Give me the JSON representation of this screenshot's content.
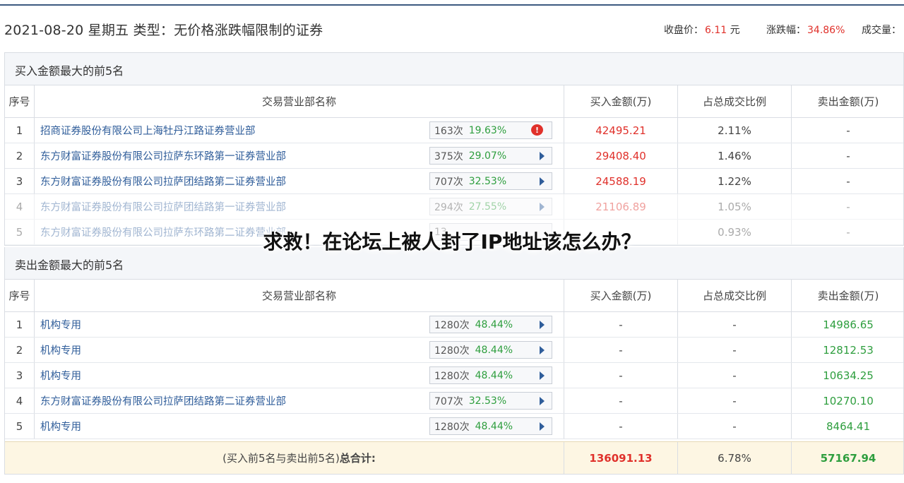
{
  "header": {
    "title": "2021-08-20 星期五 类型：无价格涨跌幅限制的证券",
    "close_label": "收盘价：",
    "close_value": "6.11",
    "close_unit": "元",
    "change_label": "涨跌幅：",
    "change_value": "34.86%",
    "volume_label": "成交量："
  },
  "columns": {
    "idx": "序号",
    "name": "交易营业部名称",
    "buy": "买入金额(万)",
    "pct": "占总成交比例",
    "sell": "卖出金额(万)"
  },
  "buy_section": {
    "title": "买入金额最大的前5名",
    "rows": [
      {
        "idx": "1",
        "name": "招商证券股份有限公司上海牡丹江路证券营业部",
        "count": "163次",
        "pct": "19.63%",
        "buy": "42495.21",
        "ratio": "2.11%",
        "sell": "-"
      },
      {
        "idx": "2",
        "name": "东方财富证券股份有限公司拉萨东环路第一证券营业部",
        "count": "375次",
        "pct": "29.07%",
        "buy": "29408.40",
        "ratio": "1.46%",
        "sell": "-"
      },
      {
        "idx": "3",
        "name": "东方财富证券股份有限公司拉萨团结路第二证券营业部",
        "count": "707次",
        "pct": "32.53%",
        "buy": "24588.19",
        "ratio": "1.22%",
        "sell": "-"
      },
      {
        "idx": "4",
        "name": "东方财富证券股份有限公司拉萨团结路第一证券营业部",
        "count": "294次",
        "pct": "27.55%",
        "buy": "21106.89",
        "ratio": "1.05%",
        "sell": "-"
      },
      {
        "idx": "5",
        "name": "东方财富证券股份有限公司拉萨东环路第二证券营业部",
        "count": "13",
        "pct": "",
        "buy": "",
        "ratio": "0.93%",
        "sell": "-"
      }
    ]
  },
  "sell_section": {
    "title": "卖出金额最大的前5名",
    "rows": [
      {
        "idx": "1",
        "name": "机构专用",
        "count": "1280次",
        "pct": "48.44%",
        "buy": "-",
        "ratio": "-",
        "sell": "14986.65"
      },
      {
        "idx": "2",
        "name": "机构专用",
        "count": "1280次",
        "pct": "48.44%",
        "buy": "-",
        "ratio": "-",
        "sell": "12812.53"
      },
      {
        "idx": "3",
        "name": "机构专用",
        "count": "1280次",
        "pct": "48.44%",
        "buy": "-",
        "ratio": "-",
        "sell": "10634.25"
      },
      {
        "idx": "4",
        "name": "东方财富证券股份有限公司拉萨团结路第二证券营业部",
        "count": "707次",
        "pct": "32.53%",
        "buy": "-",
        "ratio": "-",
        "sell": "10270.10"
      },
      {
        "idx": "5",
        "name": "机构专用",
        "count": "1280次",
        "pct": "48.44%",
        "buy": "-",
        "ratio": "-",
        "sell": "8464.41"
      }
    ]
  },
  "total": {
    "label_prefix": "(买入前5名与卖出前5名)",
    "label_bold": "总合计:",
    "buy": "136091.13",
    "ratio": "6.78%",
    "sell": "57167.94"
  },
  "overlay_text": "求救！在论坛上被人封了IP地址该怎么办？",
  "colors": {
    "up": "#e0312b",
    "down": "#2e9e3e",
    "link": "#2f5d9a"
  }
}
